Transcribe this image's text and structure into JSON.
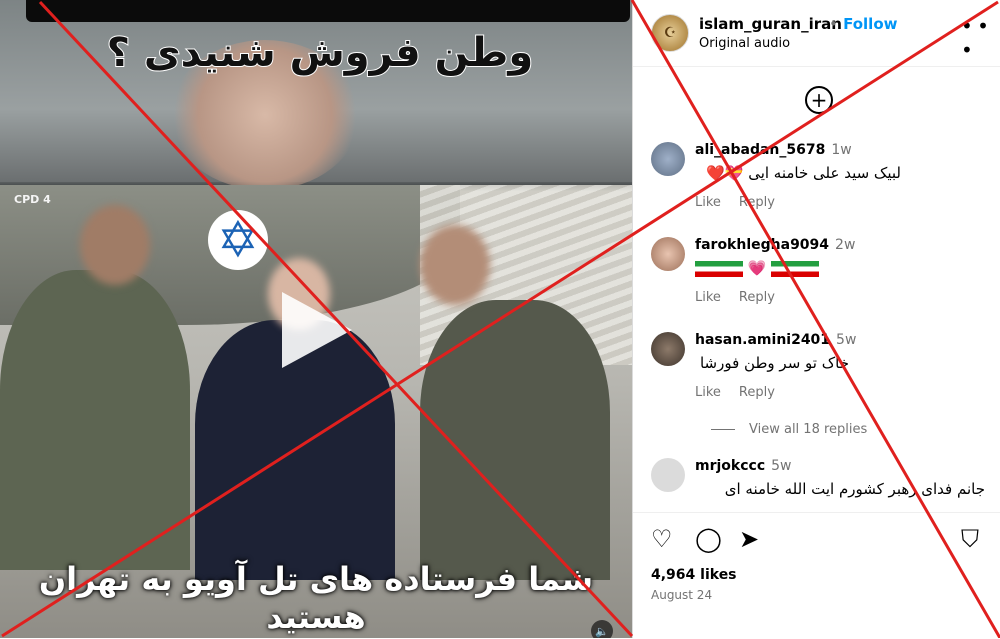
{
  "post": {
    "video": {
      "overlay_top": "وطن فروش شنیدی ؟",
      "overlay_bottom": "شما فرستاده های تل آویو به تهران هستید",
      "channel_logo": "CPD 4"
    },
    "header": {
      "username": "islam_guran_iran",
      "separator": "•",
      "follow_label": "Follow",
      "audio_label": "Original audio",
      "more_icon": "more-options-icon"
    },
    "comments": [
      {
        "username": "ali_abadan_5678",
        "time": "1w",
        "text": "لبیک سید علی خامنه ایی",
        "emojis": "💝❤️",
        "like_label": "Like",
        "reply_label": "Reply"
      },
      {
        "username": "farokhlegha9094",
        "time": "2w",
        "text": "",
        "like_label": "Like",
        "reply_label": "Reply"
      },
      {
        "username": "hasan.amini2401",
        "time": "5w",
        "text": "خاک تو سر وطن فورشا",
        "like_label": "Like",
        "reply_label": "Reply"
      },
      {
        "username": "mrjokccc",
        "time": "5w",
        "text": "جانم فدای رهبر کشورم ایت الله خامنه ای"
      }
    ],
    "view_replies_label": "View all 18 replies",
    "actions": {
      "likes_count": "4,964 likes",
      "date": "August 24"
    },
    "colors": {
      "follow": "#0095f6",
      "secondary_text": "#737373",
      "cross": "#e0201e"
    }
  }
}
